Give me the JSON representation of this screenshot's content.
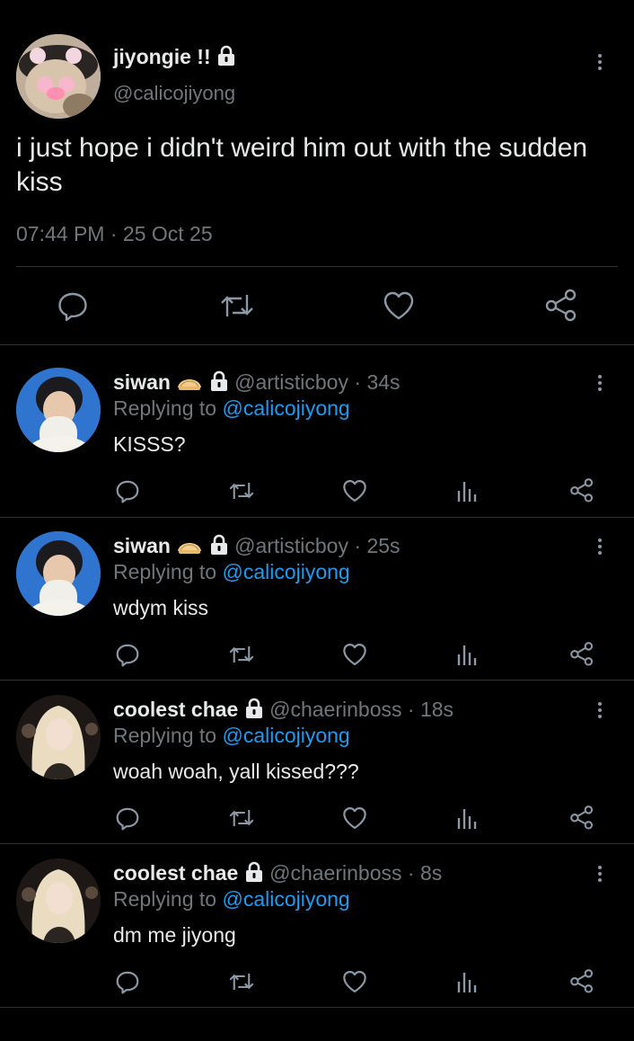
{
  "main_tweet": {
    "display_name": "jiyongie !!",
    "handle": "@calicojiyong",
    "text": "i just hope i didn't weird him out with the sudden kiss",
    "time": "07:44 PM",
    "separator": "·",
    "date": "25 Oct 25"
  },
  "icons": {
    "reply": "reply-icon",
    "retweet": "retweet-icon",
    "like": "heart-icon",
    "share": "share-icon",
    "views": "views-icon",
    "lock": "lock-icon",
    "more": "more-vertical-icon"
  },
  "colors": {
    "background": "#000000",
    "text": "#e7e9ea",
    "muted": "#71767b",
    "link": "#1d9bf0",
    "divider": "#2f3336"
  },
  "replies": [
    {
      "display_name": "siwan",
      "handle": "@artisticboy",
      "time": "34s",
      "replying_prefix": "Replying to",
      "replying_to": "@calicojiyong",
      "text": "KISSS?"
    },
    {
      "display_name": "siwan",
      "handle": "@artisticboy",
      "time": "25s",
      "replying_prefix": "Replying to",
      "replying_to": "@calicojiyong",
      "text": "wdym kiss"
    },
    {
      "display_name": "coolest chae",
      "handle": "@chaerinboss",
      "time": "18s",
      "replying_prefix": "Replying to",
      "replying_to": "@calicojiyong",
      "text": "woah woah, yall kissed???"
    },
    {
      "display_name": "coolest chae",
      "handle": "@chaerinboss",
      "time": "8s",
      "replying_prefix": "Replying to",
      "replying_to": "@calicojiyong",
      "text": "dm me jiyong"
    }
  ]
}
